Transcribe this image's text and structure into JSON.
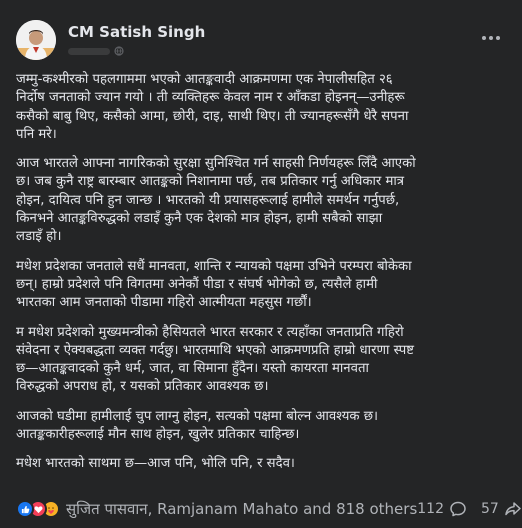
{
  "post": {
    "author": {
      "name": "CM Satish Singh"
    },
    "paragraphs": [
      {
        "lines": [
          "जम्मु-कश्मीरको पहलगाममा भएको आतङ्कवादी आक्रमणमा एक नेपालीसहित २६",
          "निर्दोष जनताको ज्यान गयो । ती व्यक्तिहरू केवल नाम र आँकडा होइनन्—उनीहरू",
          "कसैको बाबु थिए, कसैको आमा, छोरी, दाइ, साथी थिए। ती ज्यानहरूसँगै धेरै सपना",
          "पनि मरे।"
        ]
      },
      {
        "lines": [
          "आज भारतले आफ्ना नागरिकको सुरक्षा सुनिश्चित गर्न साहसी निर्णयहरू लिँदै आएको",
          "छ। जब कुनै राष्ट्र बारम्बार आतङ्कको निशानामा पर्छ, तब प्रतिकार गर्नु अधिकार मात्र",
          "होइन, दायित्व पनि हुन जान्छ । भारतको यी प्रयासहरूलाई हामीले समर्थन गर्नुपर्छ,",
          "किनभने आतङ्कविरुद्धको लडाइँ कुनै एक देशको मात्र होइन, हामी सबैको साझा",
          "लडाइँ हो।"
        ]
      },
      {
        "lines": [
          "मधेश प्रदेशका जनताले सधैं मानवता, शान्ति र न्यायको पक्षमा उभिने परम्परा बोकेका",
          "छन्। हाम्रो प्रदेशले पनि विगतमा अनेकौं पीडा र संघर्ष भोगेको छ, त्यसैले हामी",
          "भारतका आम जनताको पीडामा गहिरो आत्मीयता महसुस गर्छौं।"
        ]
      },
      {
        "lines": [
          "म मधेश प्रदेशको मुख्यमन्त्रीको हैसियतले भारत सरकार र त्यहाँका जनताप्रति गहिरो",
          "संवेदना र ऐक्यबद्धता व्यक्त गर्दछु। भारतमाथि भएको आक्रमणप्रति हाम्रो धारणा स्पष्ट",
          "छ—आतङ्कवादको कुनै धर्म, जात, वा सिमाना हुँदैन। यस्तो कायरता मानवता",
          "विरुद्धको अपराध हो, र यसको प्रतिकार आवश्यक छ।"
        ]
      },
      {
        "lines": [
          "आजको घडीमा हामीलाई चुप लाग्नु होइन, सत्यको पक्षमा बोल्न आवश्यक छ।",
          "आतङ्ककारीहरूलाई मौन साथ होइन, खुलेर प्रतिकार चाहिन्छ।"
        ]
      },
      {
        "lines": [
          "मधेश भारतको साथमा छ—आज पनि, भोलि पनि, र सदैव।"
        ]
      }
    ],
    "reactions": {
      "icons": [
        "like-icon",
        "love-icon",
        "care-icon"
      ],
      "summary": "सुजित पासवान, Ramjanam Mahato and 818 others"
    },
    "comment_count": "112",
    "share_count": "57"
  },
  "colors": {
    "background": "#18191a",
    "card": "#242526",
    "text_primary": "#e4e6eb",
    "text_secondary": "#b0b3b8",
    "like": "#1877f2",
    "love": "#f33e58",
    "care": "#f7b125"
  }
}
